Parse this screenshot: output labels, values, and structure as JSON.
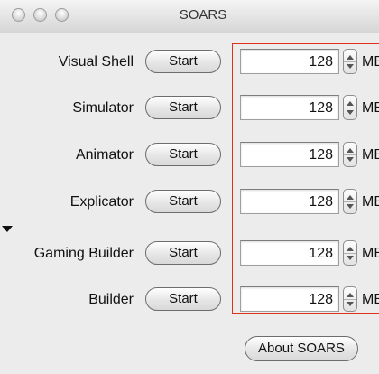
{
  "window": {
    "title": "SOARS"
  },
  "rows": [
    {
      "label": "Visual Shell",
      "button": "Start",
      "memory": "128",
      "unit": "MB"
    },
    {
      "label": "Simulator",
      "button": "Start",
      "memory": "128",
      "unit": "MB"
    },
    {
      "label": "Animator",
      "button": "Start",
      "memory": "128",
      "unit": "MB"
    },
    {
      "label": "Explicator",
      "button": "Start",
      "memory": "128",
      "unit": "MB"
    },
    {
      "label": "Gaming Builder",
      "button": "Start",
      "memory": "128",
      "unit": "MB"
    },
    {
      "label": "Builder",
      "button": "Start",
      "memory": "128",
      "unit": "MB"
    }
  ],
  "footer": {
    "about_label": "About SOARS"
  },
  "colors": {
    "highlight": "#e0301e"
  }
}
